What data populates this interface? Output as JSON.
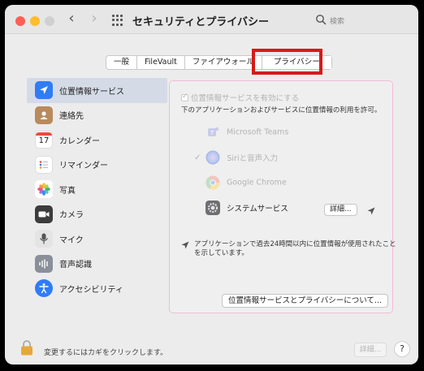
{
  "window": {
    "title": "セキュリティとプライバシー",
    "search_placeholder": "検索"
  },
  "tabs": [
    {
      "label": "一般"
    },
    {
      "label": "FileVault"
    },
    {
      "label": "ファイアウォール"
    },
    {
      "label": "プライバシー",
      "active": true
    }
  ],
  "sidebar": {
    "items": [
      {
        "label": "位置情報サービス",
        "icon": "location-arrow-icon",
        "selected": true
      },
      {
        "label": "連絡先",
        "icon": "contacts-icon"
      },
      {
        "label": "カレンダー",
        "icon": "calendar-icon",
        "badge": "17"
      },
      {
        "label": "リマインダー",
        "icon": "reminders-icon"
      },
      {
        "label": "写真",
        "icon": "photos-icon"
      },
      {
        "label": "カメラ",
        "icon": "camera-icon"
      },
      {
        "label": "マイク",
        "icon": "microphone-icon"
      },
      {
        "label": "音声認識",
        "icon": "speech-recognition-icon"
      },
      {
        "label": "アクセシビリティ",
        "icon": "accessibility-icon"
      }
    ]
  },
  "panel": {
    "enable_label": "位置情報サービスを有効にする",
    "description": "下のアプリケーションおよびサービスに位置情報の利用を許可。",
    "apps": [
      {
        "name": "Microsoft Teams",
        "icon": "teams-icon",
        "checked": false,
        "enabled": false
      },
      {
        "name": "Siriと音声入力",
        "icon": "siri-icon",
        "checked": true,
        "enabled": false
      },
      {
        "name": "Google Chrome",
        "icon": "chrome-icon",
        "checked": false,
        "enabled": false
      },
      {
        "name": "システムサービス",
        "icon": "system-services-icon",
        "checked": false,
        "enabled": true
      }
    ],
    "details_button": "詳細...",
    "recent_note_line1": "アプリケーションで過去24時間以内に位置情報が使用されたこと",
    "recent_note_line2": "を示しています。",
    "about_button": "位置情報サービスとプライバシーについて..."
  },
  "footer": {
    "lock_text": "変更するにはカギをクリックします。",
    "details_button": "詳細...",
    "help_label": "?"
  },
  "colors": {
    "highlight_red": "#d61a1a",
    "selection": "#d5dbe6",
    "panel_border": "#f0bcd8"
  }
}
